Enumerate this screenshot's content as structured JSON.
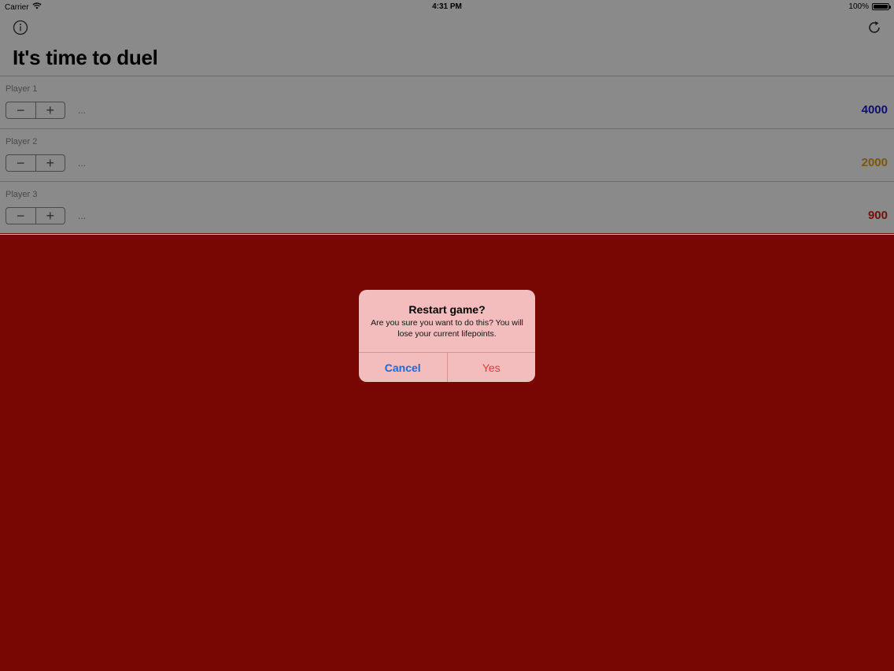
{
  "status_bar": {
    "carrier": "Carrier",
    "time": "4:31 PM",
    "battery_label": "100%",
    "battery_level": 1.0,
    "icons": [
      "wifi-icon",
      "battery-icon"
    ]
  },
  "nav": {
    "icons": [
      "info-icon",
      "refresh-icon"
    ]
  },
  "page": {
    "title": "It's time to duel"
  },
  "stepper": {
    "minus_label": "−",
    "plus_label": "+"
  },
  "players": [
    {
      "name": "Player 1",
      "note": "...",
      "points": "4000",
      "points_color": "#1a1ad6"
    },
    {
      "name": "Player 2",
      "note": "...",
      "points": "2000",
      "points_color": "#e0a020"
    },
    {
      "name": "Player 3",
      "note": "...",
      "points": "900",
      "points_color": "#d91c1c"
    }
  ],
  "background_color": "#780704",
  "alert": {
    "title": "Restart game?",
    "message": "Are you sure you want to do this? You will lose your current lifepoints.",
    "cancel_label": "Cancel",
    "confirm_label": "Yes",
    "cancel_color": "#1e67d6",
    "confirm_color": "#e53a3a"
  }
}
